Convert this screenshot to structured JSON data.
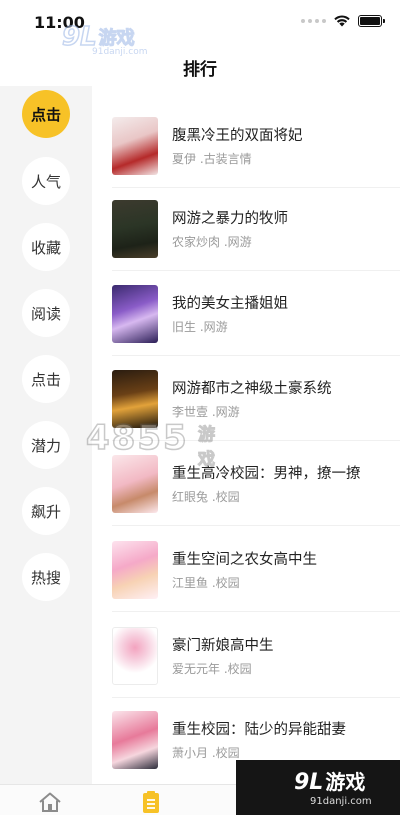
{
  "status_bar": {
    "time": "11:00"
  },
  "watermark": {
    "brand_num": "9L",
    "brand_cn": "游戏",
    "url": "91danji.com",
    "center_num": "4855",
    "center_cn": "游戏"
  },
  "header": {
    "title": "排行"
  },
  "sidebar": {
    "items": [
      {
        "label": "点击",
        "active": true
      },
      {
        "label": "人气",
        "active": false
      },
      {
        "label": "收藏",
        "active": false
      },
      {
        "label": "阅读",
        "active": false
      },
      {
        "label": "点击",
        "active": false
      },
      {
        "label": "潜力",
        "active": false
      },
      {
        "label": "飙升",
        "active": false
      },
      {
        "label": "热搜",
        "active": false
      }
    ]
  },
  "books": [
    {
      "title": "腹黑冷王的双面将妃",
      "meta": "夏伊 .古装言情"
    },
    {
      "title": "网游之暴力的牧师",
      "meta": "农家炒肉 .网游"
    },
    {
      "title": "我的美女主播姐姐",
      "meta": "旧生 .网游"
    },
    {
      "title": "网游都市之神级土豪系统",
      "meta": "李世壹 .网游"
    },
    {
      "title": "重生高冷校园：男神，撩一撩",
      "meta": "红眼兔 .校园"
    },
    {
      "title": "重生空间之农女高中生",
      "meta": "江里鱼 .校园"
    },
    {
      "title": "豪门新娘高中生",
      "meta": "爱无元年 .校园"
    },
    {
      "title": "重生校园：陆少的异能甜妻",
      "meta": "萧小月 .校园"
    }
  ],
  "colors": {
    "accent": "#f7c227",
    "sidebar_bg": "#f4f4f4",
    "meta_text": "#9a9a9a"
  }
}
